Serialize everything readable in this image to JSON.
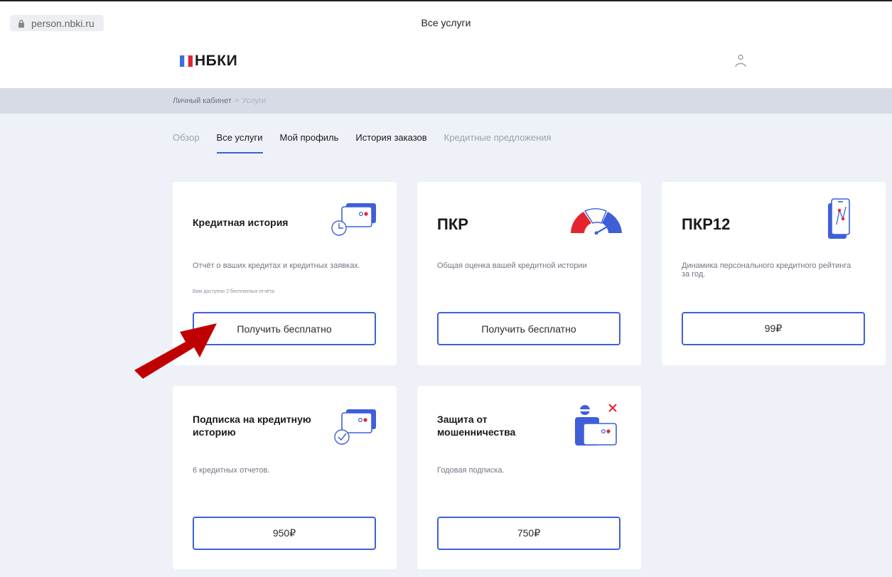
{
  "browser": {
    "url": "person.nbki.ru",
    "tab_title": "Все услуги"
  },
  "header": {
    "logo_text": "НБКИ"
  },
  "breadcrumb": {
    "root": "Личный кабинет",
    "separator": ">",
    "current": "Услуги"
  },
  "nav": {
    "tabs": [
      {
        "label": "Обзор"
      },
      {
        "label": "Все услуги"
      },
      {
        "label": "Мой профиль"
      },
      {
        "label": "История заказов"
      },
      {
        "label": "Кредитные предложения"
      }
    ],
    "active_index": 1
  },
  "cards": [
    {
      "title": "Кредитная история",
      "desc": "Отчёт о ваших кредитах и кредитных заявках.",
      "note": "Вам доступно 2 бесплатных отчёта",
      "button": "Получить бесплатно",
      "icon": "credit-card-clock-icon"
    },
    {
      "title": "ПКР",
      "desc": "Общая оценка вашей кредитной истории",
      "note": "",
      "button": "Получить бесплатно",
      "icon": "gauge-icon"
    },
    {
      "title": "ПКР12",
      "desc": "Динамика персонального кредитного рейтинга за год.",
      "note": "",
      "button": "99₽",
      "icon": "phone-chart-icon"
    },
    {
      "title": "Подписка на кредитную историю",
      "desc": "6 кредитных отчетов.",
      "note": "",
      "button": "950₽",
      "icon": "credit-card-check-icon"
    },
    {
      "title": "Защита от мошенничества",
      "desc": "Годовая подписка.",
      "note": "",
      "button": "750₽",
      "icon": "fraud-protection-icon"
    }
  ],
  "colors": {
    "accent": "#3f5fd9",
    "arrow": "#c00000",
    "background": "#eef1f7",
    "red": "#e4252f"
  }
}
